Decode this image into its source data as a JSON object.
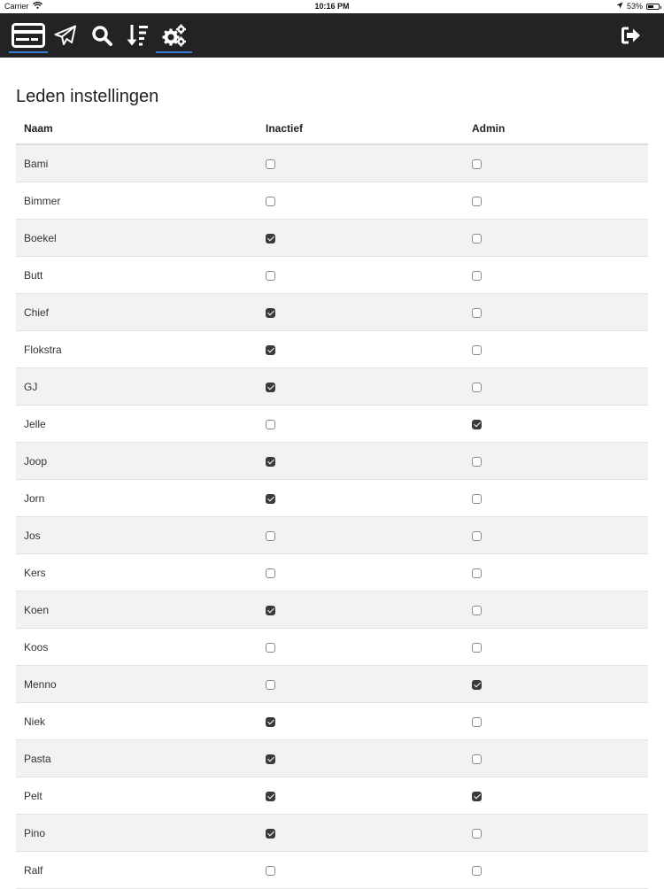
{
  "status_bar": {
    "carrier": "Carrier",
    "time": "10:16 PM",
    "battery": "53%",
    "battery_level": 0.53
  },
  "navbar": {
    "items": [
      {
        "icon": "credit-card-icon",
        "active": true
      },
      {
        "icon": "paper-plane-icon",
        "active": false
      },
      {
        "icon": "search-icon",
        "active": false
      },
      {
        "icon": "sort-descending-icon",
        "active": false
      },
      {
        "icon": "cogs-icon",
        "active": true
      }
    ],
    "logout_icon": "sign-out-icon",
    "active_indicator_color": "#3d7bd9"
  },
  "page": {
    "title": "Leden instellingen"
  },
  "table": {
    "headers": {
      "name": "Naam",
      "inactive": "Inactief",
      "admin": "Admin"
    },
    "rows": [
      {
        "name": "Bami",
        "inactive": false,
        "admin": false
      },
      {
        "name": "Bimmer",
        "inactive": false,
        "admin": false
      },
      {
        "name": "Boekel",
        "inactive": true,
        "admin": false
      },
      {
        "name": "Butt",
        "inactive": false,
        "admin": false
      },
      {
        "name": "Chief",
        "inactive": true,
        "admin": false
      },
      {
        "name": "Flokstra",
        "inactive": true,
        "admin": false
      },
      {
        "name": "GJ",
        "inactive": true,
        "admin": false
      },
      {
        "name": "Jelle",
        "inactive": false,
        "admin": true
      },
      {
        "name": "Joop",
        "inactive": true,
        "admin": false
      },
      {
        "name": "Jorn",
        "inactive": true,
        "admin": false
      },
      {
        "name": "Jos",
        "inactive": false,
        "admin": false
      },
      {
        "name": "Kers",
        "inactive": false,
        "admin": false
      },
      {
        "name": "Koen",
        "inactive": true,
        "admin": false
      },
      {
        "name": "Koos",
        "inactive": false,
        "admin": false
      },
      {
        "name": "Menno",
        "inactive": false,
        "admin": true
      },
      {
        "name": "Niek",
        "inactive": true,
        "admin": false
      },
      {
        "name": "Pasta",
        "inactive": true,
        "admin": false
      },
      {
        "name": "Pelt",
        "inactive": true,
        "admin": true
      },
      {
        "name": "Pino",
        "inactive": true,
        "admin": false
      },
      {
        "name": "Ralf",
        "inactive": false,
        "admin": false
      }
    ]
  }
}
